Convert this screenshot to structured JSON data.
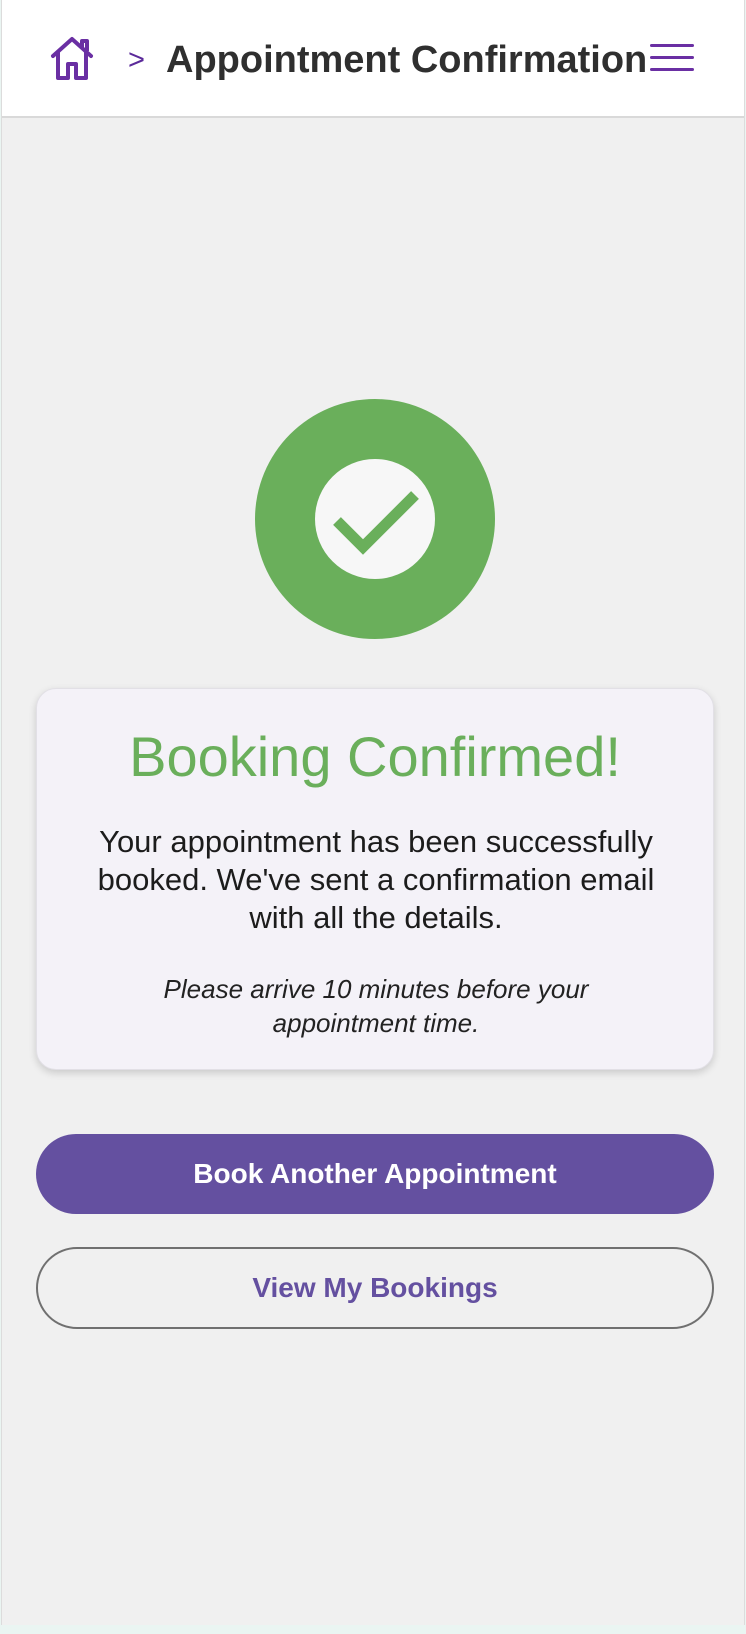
{
  "header": {
    "home_icon": "home-icon",
    "breadcrumb_separator": ">",
    "title": "Appointment Confirmation",
    "menu_icon": "hamburger-menu-icon"
  },
  "status": {
    "icon": "checkmark-icon",
    "color": "#6aaf5b"
  },
  "card": {
    "title": "Booking Confirmed!",
    "message": "Your appointment has been successfully booked. We've sent a confirmation email with all the details.",
    "note": "Please arrive 10 minutes before your appointment time."
  },
  "actions": {
    "primary_label": "Book Another Appointment",
    "secondary_label": "View My Bookings"
  },
  "colors": {
    "accent": "#6450a0",
    "icon_purple": "#6a2fa3",
    "success": "#6aaf5b"
  }
}
